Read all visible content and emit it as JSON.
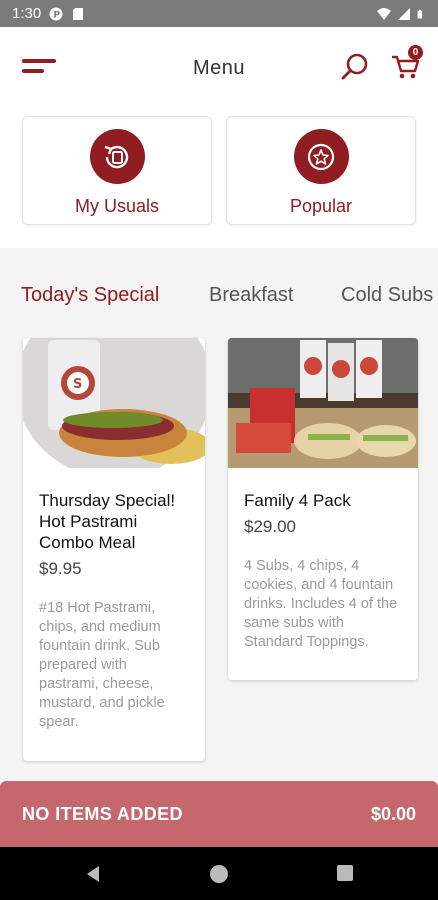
{
  "status_bar": {
    "time": "1:30"
  },
  "appbar": {
    "title": "Menu",
    "cart_count": "0"
  },
  "quick_links": [
    {
      "label": "My Usuals",
      "icon": "refresh-cup-icon"
    },
    {
      "label": "Popular",
      "icon": "star-icon"
    }
  ],
  "tabs": [
    {
      "label": "Today's Special",
      "active": true
    },
    {
      "label": "Breakfast",
      "active": false
    },
    {
      "label": "Cold Subs",
      "active": false
    }
  ],
  "items": [
    {
      "name": "Thursday Special! Hot Pastrami Combo Meal",
      "price": "$9.95",
      "description": "#18 Hot Pastrami, chips, and medium fountain drink. Sub prepared with pastrami, cheese, mustard, and pickle spear."
    },
    {
      "name": "Family 4 Pack",
      "price": "$29.00",
      "description": "4 Subs, 4 chips, 4 cookies, and 4 fountain drinks. Includes 4 of the same subs with Standard Toppings."
    }
  ],
  "cart_bar": {
    "message": "NO ITEMS ADDED",
    "total": "$0.00"
  },
  "colors": {
    "brand": "#8f1d21",
    "cart_bar": "#c4686d"
  }
}
